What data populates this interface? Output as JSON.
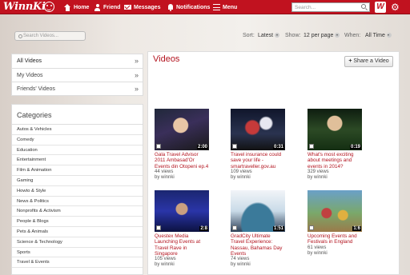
{
  "header": {
    "logo": "WinnKi",
    "nav": [
      "Home",
      "Friend",
      "Messages",
      "Notifications",
      "Menu"
    ],
    "search_placeholder": "Search...",
    "brand_badge": "W",
    "accent": "#c1121f"
  },
  "filters": {
    "search_placeholder": "Search Videos...",
    "sort_label": "Sort:",
    "sort_value": "Latest",
    "show_label": "Show:",
    "show_value": "12 per page",
    "when_label": "When:",
    "when_value": "All Time"
  },
  "sidebar": {
    "items": [
      {
        "label": "All Videos"
      },
      {
        "label": "My Videos"
      },
      {
        "label": "Friends' Videos"
      }
    ],
    "chevron": "»"
  },
  "categories": {
    "title": "Categories",
    "items": [
      "Autos & Vehicles",
      "Comedy",
      "Education",
      "Entertainment",
      "Film & Animation",
      "Gaming",
      "Howto & Style",
      "News & Politics",
      "Nonprofits & Activism",
      "People & Blogs",
      "Pets & Animals",
      "Science & Technology",
      "Sports",
      "Travel & Events"
    ]
  },
  "main": {
    "title": "Videos",
    "share_label": "Share a Video"
  },
  "videos": [
    {
      "title": "Gala Travel Advisor 2011 Ambasad'Or Events din Otopeni ep.4",
      "views": "44 views",
      "by": "by winnki",
      "duration": "2:00"
    },
    {
      "title": "Travel insurance could save your life - smartraveller.gov.au",
      "views": "109 views",
      "by": "by winnki",
      "duration": "0:31"
    },
    {
      "title": "What's most exciting about meetings and events in 2014?",
      "views": "329 views",
      "by": "by winnki",
      "duration": "0:19"
    },
    {
      "title": "Questex Media Launching Events at Travel Rave in Singapore",
      "views": "105 views",
      "by": "by winnki",
      "duration": "2:8"
    },
    {
      "title": "GradCity Ultimate Travel Experience: Nassau, Bahamas Day Events",
      "views": "74 views",
      "by": "by winnki",
      "duration": "1:51"
    },
    {
      "title": "Upcoming Events and Festivals in England",
      "views": "61 views",
      "by": "by winnki",
      "duration": "1:6"
    }
  ]
}
